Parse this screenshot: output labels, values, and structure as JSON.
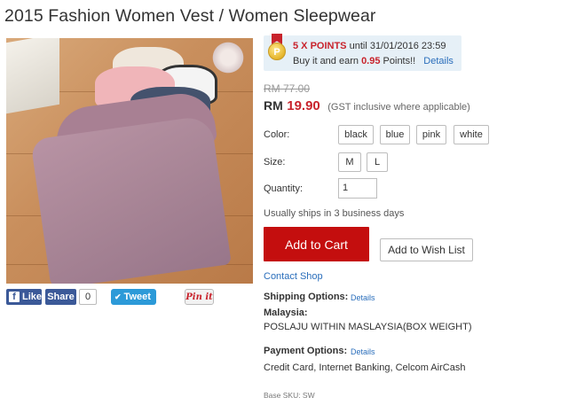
{
  "product": {
    "title": "2015 Fashion Women Vest / Women Sleepwear"
  },
  "social": {
    "like_label": "Like",
    "fb_icon": "f",
    "share_label": "Share",
    "share_count": "0",
    "tweet_label": "Tweet",
    "tweet_icon": "✔",
    "pin_label": "Pin it"
  },
  "promo": {
    "points_title": "5 X POINTS",
    "until_text": " until 31/01/2016 23:59",
    "earn_prefix": "Buy it and earn ",
    "earn_points": "0.95",
    "earn_suffix": " Points!!",
    "details_label": "Details",
    "medal_letter": "P"
  },
  "pricing": {
    "old_price": "RM 77.00",
    "currency": "RM",
    "price": "19.90",
    "note": "(GST inclusive where applicable)"
  },
  "options": {
    "color_label": "Color:",
    "colors": [
      "black",
      "blue",
      "pink",
      "white"
    ],
    "size_label": "Size:",
    "sizes": [
      "M",
      "L"
    ],
    "quantity_label": "Quantity:",
    "quantity_value": "1"
  },
  "shipping_note": "Usually ships in 3 business days",
  "actions": {
    "add_to_cart": "Add to Cart",
    "add_to_wishlist": "Add to Wish List",
    "contact_shop": "Contact Shop"
  },
  "shipping": {
    "label": "Shipping Options:",
    "details_label": "Details",
    "region": "Malaysia:",
    "method": "POSLAJU WITHIN MASLAYSIA(BOX WEIGHT)"
  },
  "payment": {
    "label": "Payment Options:",
    "details_label": "Details",
    "methods": "Credit Card, Internet Banking, Celcom AirCash"
  },
  "sku": "Base SKU: SW",
  "colors": {
    "accent_red": "#c40e0e",
    "price_red": "#c8232c",
    "link_blue": "#2a6ebb",
    "facebook_blue": "#3b5998",
    "twitter_blue": "#2c9ad8",
    "promo_bg": "#e6f0f7"
  }
}
